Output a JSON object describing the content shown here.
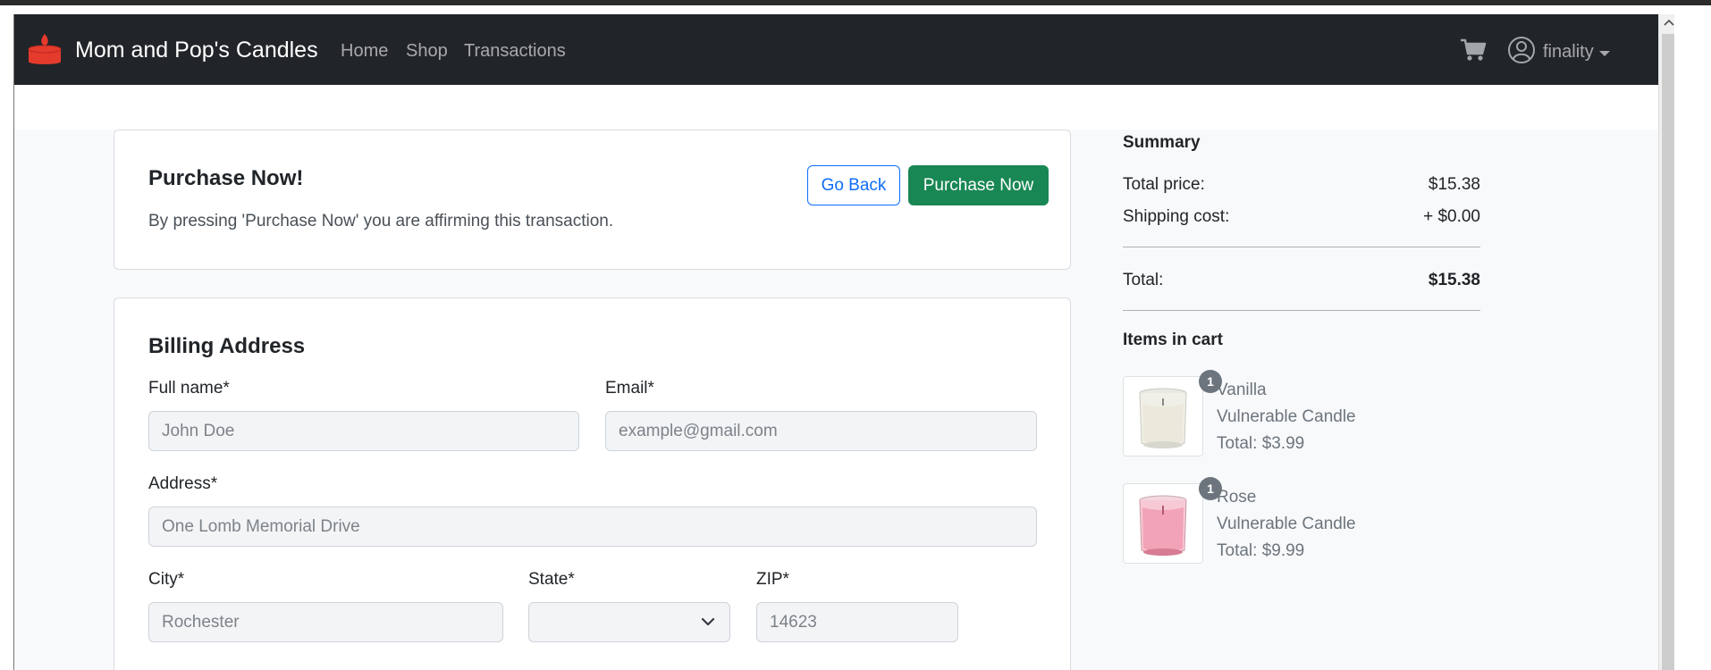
{
  "app": {
    "brand": "Mom and Pop's Candles",
    "nav": [
      "Home",
      "Shop",
      "Transactions"
    ],
    "user": "finality"
  },
  "purchase": {
    "title": "Purchase Now!",
    "text": "By pressing 'Purchase Now' you are affirming this transaction.",
    "back_label": "Go Back",
    "purchase_label": "Purchase Now"
  },
  "billing": {
    "title": "Billing Address",
    "full_name_label": "Full name*",
    "full_name_placeholder": "John Doe",
    "email_label": "Email*",
    "email_placeholder": "example@gmail.com",
    "address_label": "Address*",
    "address_placeholder": "One Lomb Memorial Drive",
    "city_label": "City*",
    "city_placeholder": "Rochester",
    "state_label": "State*",
    "state_value": "",
    "zip_label": "ZIP*",
    "zip_placeholder": "14623"
  },
  "summary": {
    "heading": "Summary",
    "total_price_label": "Total price:",
    "total_price_value": "$15.38",
    "shipping_label": "Shipping cost:",
    "shipping_value": "+ $0.00",
    "total_label": "Total:",
    "total_value": "$15.38",
    "items_heading": "Items in cart",
    "items": [
      {
        "quantity": "1",
        "scent": "Vanilla",
        "name": "Vulnerable Candle",
        "total": "Total: $3.99",
        "candle_color": "#ece9dc"
      },
      {
        "quantity": "1",
        "scent": "Rose",
        "name": "Vulnerable Candle",
        "total": "Total: $9.99",
        "candle_color": "#f2a3b8"
      }
    ]
  },
  "colors": {
    "navbar": "#212529",
    "brand_icon": "#e53b2c",
    "primary": "#0d6efd",
    "success": "#198754"
  }
}
